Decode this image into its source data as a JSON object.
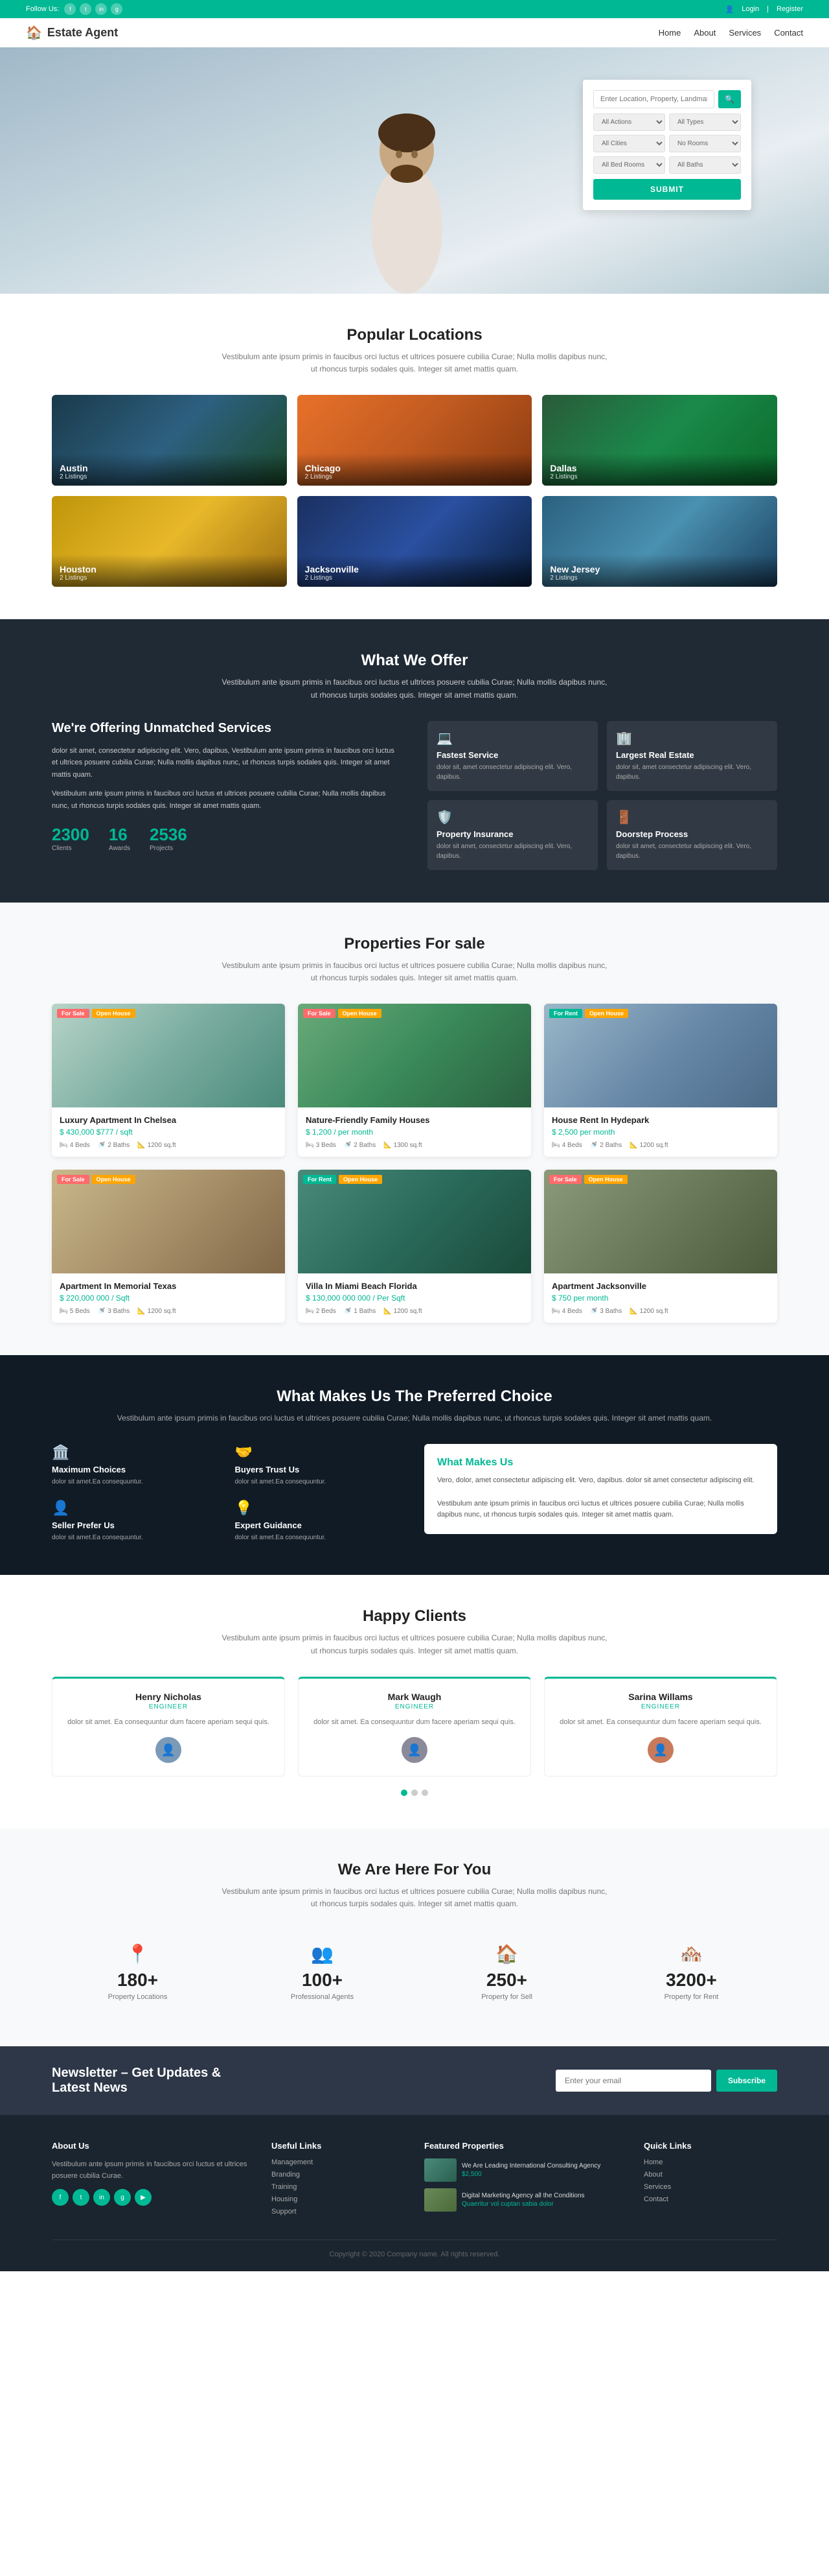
{
  "topbar": {
    "follow_label": "Follow Us:",
    "login": "Login",
    "register": "Register",
    "socials": [
      "f",
      "t",
      "in",
      "g+"
    ]
  },
  "header": {
    "logo_icon": "🏠",
    "logo_text": "Estate Agent",
    "nav": [
      "Home",
      "About",
      "Services",
      "Contact"
    ]
  },
  "hero": {
    "search_placeholder": "Enter Location, Property, Landmark",
    "all_actions": "All Actions",
    "all_types": "All Types",
    "all_cities": "All Cities",
    "no_rooms": "No Rooms",
    "all_bed_rooms": "All Bed Rooms",
    "all_baths": "All Baths",
    "submit_label": "SUBMIT"
  },
  "popular": {
    "title": "Popular Locations",
    "subtitle": "Vestibulum ante ipsum primis in faucibus orci luctus et ultrices posuere cubilia Curae; Nulla mollis dapibus nunc, ut rhoncus turpis sodales quis. Integer sit amet mattis quam.",
    "locations": [
      {
        "name": "Austin",
        "count": "2 Listings",
        "bg": "loc-bg-austin"
      },
      {
        "name": "Chicago",
        "count": "2 Listings",
        "bg": "loc-bg-chicago"
      },
      {
        "name": "Dallas",
        "count": "2 Listings",
        "bg": "loc-bg-dallas"
      },
      {
        "name": "Houston",
        "count": "2 Listings",
        "bg": "loc-bg-houston"
      },
      {
        "name": "Jacksonville",
        "count": "2 Listings",
        "bg": "loc-bg-jacksonville"
      },
      {
        "name": "New Jersey",
        "count": "2 Listings",
        "bg": "loc-bg-newjersey"
      }
    ]
  },
  "offer": {
    "section_title": "What We Offer",
    "section_sub": "Vestibulum ante ipsum primis in faucibus orci luctus et ultrices posuere cubilia Curae; Nulla mollis dapibus nunc, ut rhoncus turpis sodales quis. Integer sit amet mattis quam.",
    "left_heading": "We're Offering Unmatched Services",
    "left_para1": "dolor sit amet, consectetur adipiscing elit. Vero, dapibus, Vestibulum ante ipsum primis in faucibus orci luctus et ultrices posuere cubilia Curae; Nulla mollis dapibus nunc, ut rhoncus turpis sodales quis. Integer sit amet mattis quam.",
    "left_para2": "Vestibulum ante ipsum primis in faucibus orci luctus et ultrices posuere cubilia Curae; Nulla mollis dapibus nunc, ut rhoncus turpis sodales quis. Integer sit amet mattis quam.",
    "stats": [
      {
        "num": "2300",
        "label": "Clients"
      },
      {
        "num": "16",
        "label": "Awards"
      },
      {
        "num": "2536",
        "label": "Projects"
      }
    ],
    "services": [
      {
        "icon": "💻",
        "title": "Fastest Service",
        "text": "dolor sit, amet consectetur adipiscing elit. Vero, dapibus."
      },
      {
        "icon": "🏢",
        "title": "Largest Real Estate",
        "text": "dolor sit, amet consectetur adipiscing elit. Vero, dapibus."
      },
      {
        "icon": "🛡️",
        "title": "Property Insurance",
        "text": "dolor sit amet, consectetur adipiscing elit. Vero, dapibus."
      },
      {
        "icon": "🚪",
        "title": "Doorstep Process",
        "text": "dolor sit amet, consectetur adipiscing elit. Vero, dapibus."
      }
    ]
  },
  "properties": {
    "title": "Properties For sale",
    "subtitle": "Vestibulum ante ipsum primis in faucibus orci luctus et ultrices posuere cubilia Curae; Nulla mollis dapibus nunc, ut rhoncus turpis sodales quis. Integer sit amet mattis quam.",
    "items": [
      {
        "name": "Luxury Apartment In Chelsea",
        "price": "$ 430,000 $777 / sqft",
        "tag1": "For Sale",
        "tag2": "Open House",
        "bg": "prop-bg-1",
        "beds": 4,
        "baths": 2,
        "sqft": "1200 sq.ft"
      },
      {
        "name": "Nature-Friendly Family Houses",
        "price": "$ 1,200 / per month",
        "tag1": "For Sale",
        "tag2": "Open House",
        "bg": "prop-bg-2",
        "beds": 3,
        "baths": 2,
        "sqft": "1300 sq.ft"
      },
      {
        "name": "House Rent In Hydepark",
        "price": "$ 2,500 per month",
        "tag1": "For Rent",
        "tag2": "Open House",
        "bg": "prop-bg-3",
        "beds": 4,
        "baths": 2,
        "sqft": "1200 sq.ft"
      },
      {
        "name": "Apartment In Memorial Texas",
        "price": "$ 220,000 000 / Sqft",
        "tag1": "For Sale",
        "tag2": "Open House",
        "bg": "prop-bg-4",
        "beds": 5,
        "baths": 3,
        "sqft": "1200 sq.ft"
      },
      {
        "name": "Villa In Miami Beach Florida",
        "price": "$ 130,000 000 000 / Per Sqft",
        "tag1": "For Rent",
        "tag2": "Open House",
        "bg": "prop-bg-5",
        "beds": 2,
        "baths": 1,
        "sqft": "1200 sq.ft"
      },
      {
        "name": "Apartment Jacksonville",
        "price": "$ 750 per month",
        "tag1": "For Sale",
        "tag2": "Open House",
        "bg": "prop-bg-6",
        "beds": 4,
        "baths": 3,
        "sqft": "1200 sq.ft"
      }
    ]
  },
  "preferred": {
    "title": "What Makes Us The Preferred Choice",
    "subtitle": "Vestibulum ante ipsum primis in faucibus orci luctus et ultrices posuere cubilia Curae; Nulla mollis dapibus nunc, ut rhoncus turpis sodales quis. Integer sit amet mattis quam.",
    "reasons": [
      {
        "icon": "🏛️",
        "title": "Maximum Choices",
        "text": "dolor sit amet.Ea consequuntur."
      },
      {
        "icon": "🤝",
        "title": "Buyers Trust Us",
        "text": "dolor sit amet.Ea consequuntur."
      },
      {
        "icon": "👤",
        "title": "Seller Prefer Us",
        "text": "dolor sit amet.Ea consequuntur."
      },
      {
        "icon": "💡",
        "title": "Expert Guidance",
        "text": "dolor sit amet.Ea consequuntur."
      }
    ],
    "box_title": "What Makes Us",
    "box_text": "Vero, dolor, amet consectetur adipiscing elit. Vero, dapibus. dolor sit amet consectetur adipiscing elit.\n\nVestibulum ante ipsum primis in faucibus orci luctus et ultrices posuere cubilia Curae; Nulla mollis dapibus nunc, ut rhoncus turpis sodales quis. Integer sit amet mattis quam."
  },
  "clients": {
    "title": "Happy Clients",
    "subtitle": "Vestibulum ante ipsum primis in faucibus orci luctus et ultrices posuere cubilia Curae; Nulla mollis dapibus nunc, ut rhoncus turpis sodales quis. Integer sit amet mattis quam.",
    "items": [
      {
        "name": "Henry Nicholas",
        "role": "ENGINEER",
        "text": "dolor sit amet. Ea consequuntur dum facere aperiam sequi quis.",
        "avatar": "👤",
        "av_class": "avatar-1"
      },
      {
        "name": "Mark Waugh",
        "role": "ENGINEER",
        "text": "dolor sit amet. Ea consequuntur dum facere aperiam sequi quis.",
        "avatar": "👤",
        "av_class": "avatar-2"
      },
      {
        "name": "Sarina Willams",
        "role": "ENGINEER",
        "text": "dolor sit amet. Ea consequuntur dum facere aperiam sequi quis.",
        "avatar": "👤",
        "av_class": "avatar-3"
      }
    ],
    "dots": [
      true,
      false,
      false
    ]
  },
  "here": {
    "title": "We Are Here For You",
    "subtitle": "Vestibulum ante ipsum primis in faucibus orci luctus et ultrices posuere cubilia Curae; Nulla mollis dapibus nunc, ut rhoncus turpis sodales quis. Integer sit amet mattis quam.",
    "stats": [
      {
        "icon": "📍",
        "num": "180+",
        "label": "Property Locations"
      },
      {
        "icon": "👥",
        "num": "100+",
        "label": "Professional Agents"
      },
      {
        "icon": "🏠",
        "num": "250+",
        "label": "Property for Sell"
      },
      {
        "icon": "🏘️",
        "num": "3200+",
        "label": "Property for Rent"
      }
    ]
  },
  "newsletter": {
    "title": "Newsletter – Get Updates & Latest News",
    "placeholder": "Enter your email",
    "button": "Subscribe"
  },
  "footer": {
    "about_title": "About Us",
    "about_text": "Vestibulum ante ipsum primis in faucibus orci luctus et ultrices posuere cubilia Curae.",
    "useful_title": "Useful Links",
    "useful_links": [
      "Management",
      "Branding",
      "Training",
      "Housing",
      "Support"
    ],
    "featured_title": "Featured Properties",
    "featured_props": [
      {
        "name": "We Are Leading International Consulting Agency",
        "price": "$2,500"
      },
      {
        "name": "Digital Marketing Agency all the Conditions",
        "price": "Quaeritur vol cuptan sabia dolor"
      }
    ],
    "quick_title": "Quick Links",
    "quick_links": [
      "Home",
      "About",
      "Services",
      "Contact"
    ],
    "copyright": "Copyright © 2020 Company name. All rights reserved."
  }
}
